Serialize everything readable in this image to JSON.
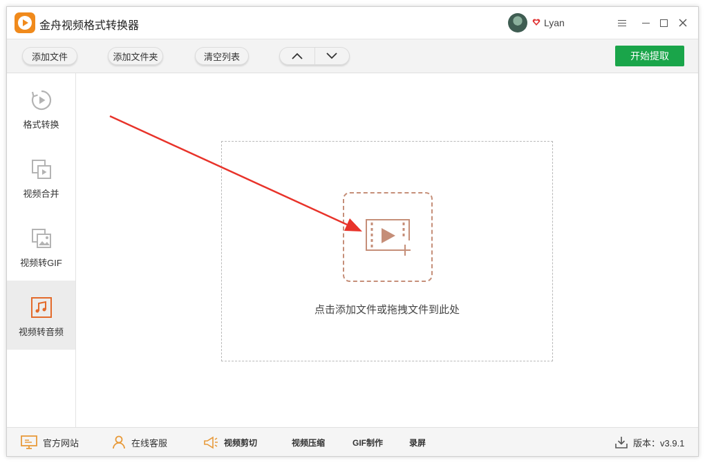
{
  "app": {
    "title": "金舟视频格式转换器",
    "user": "Lyan",
    "accent": "#1aa54a",
    "brand": "#f08a1c"
  },
  "toolbar": {
    "add_file": "添加文件",
    "add_folder": "添加文件夹",
    "clear_list": "清空列表",
    "start": "开始提取"
  },
  "sidebar": {
    "items": [
      {
        "label": "格式转换",
        "icon": "play-circle-icon"
      },
      {
        "label": "视频合并",
        "icon": "merge-icon"
      },
      {
        "label": "视频转GIF",
        "icon": "image-icon"
      },
      {
        "label": "视频转音频",
        "icon": "music-icon",
        "active": true
      }
    ]
  },
  "main": {
    "drop_text": "点击添加文件或拖拽文件到此处"
  },
  "footer": {
    "website": "官方网站",
    "support": "在线客服",
    "video_cut": "视频剪切",
    "video_compress": "视频压缩",
    "gif_make": "GIF制作",
    "record": "录屏",
    "version": "版本：v3.9.1"
  }
}
